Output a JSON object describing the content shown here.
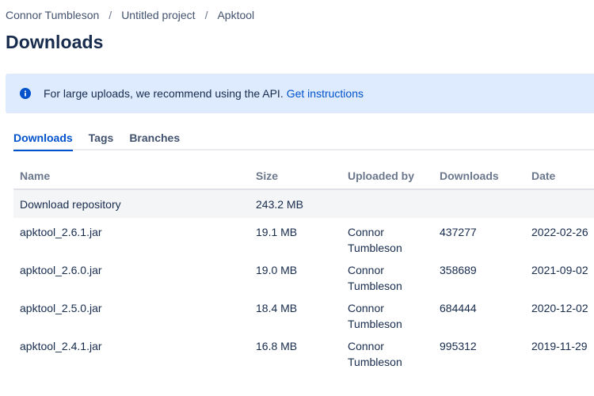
{
  "breadcrumb": {
    "items": [
      "Connor Tumbleson",
      "Untitled project",
      "Apktool"
    ],
    "separator": "/"
  },
  "page_title": "Downloads",
  "banner": {
    "icon": "info-icon",
    "text": "For large uploads, we recommend using the API.",
    "link": "Get instructions",
    "background": "#deebff"
  },
  "tabs": [
    {
      "label": "Downloads",
      "active": true
    },
    {
      "label": "Tags",
      "active": false
    },
    {
      "label": "Branches",
      "active": false
    }
  ],
  "table": {
    "headers": [
      "Name",
      "Size",
      "Uploaded by",
      "Downloads",
      "Date"
    ],
    "repository_row": {
      "name": "Download repository",
      "size": "243.2 MB"
    },
    "rows": [
      {
        "name": "apktool_2.6.1.jar",
        "size": "19.1 MB",
        "uploader_first": "Connor",
        "uploader_last": "Tumbleson",
        "downloads": "437277",
        "date": "2022-02-26"
      },
      {
        "name": "apktool_2.6.0.jar",
        "size": "19.0 MB",
        "uploader_first": "Connor",
        "uploader_last": "Tumbleson",
        "downloads": "358689",
        "date": "2021-09-02"
      },
      {
        "name": "apktool_2.5.0.jar",
        "size": "18.4 MB",
        "uploader_first": "Connor",
        "uploader_last": "Tumbleson",
        "downloads": "684444",
        "date": "2020-12-02"
      },
      {
        "name": "apktool_2.4.1.jar",
        "size": "16.8 MB",
        "uploader_first": "Connor",
        "uploader_last": "Tumbleson",
        "downloads": "995312",
        "date": "2019-11-29"
      }
    ]
  },
  "colors": {
    "accent": "#0052cc",
    "text": "#172b4d",
    "muted": "#6b778c"
  }
}
